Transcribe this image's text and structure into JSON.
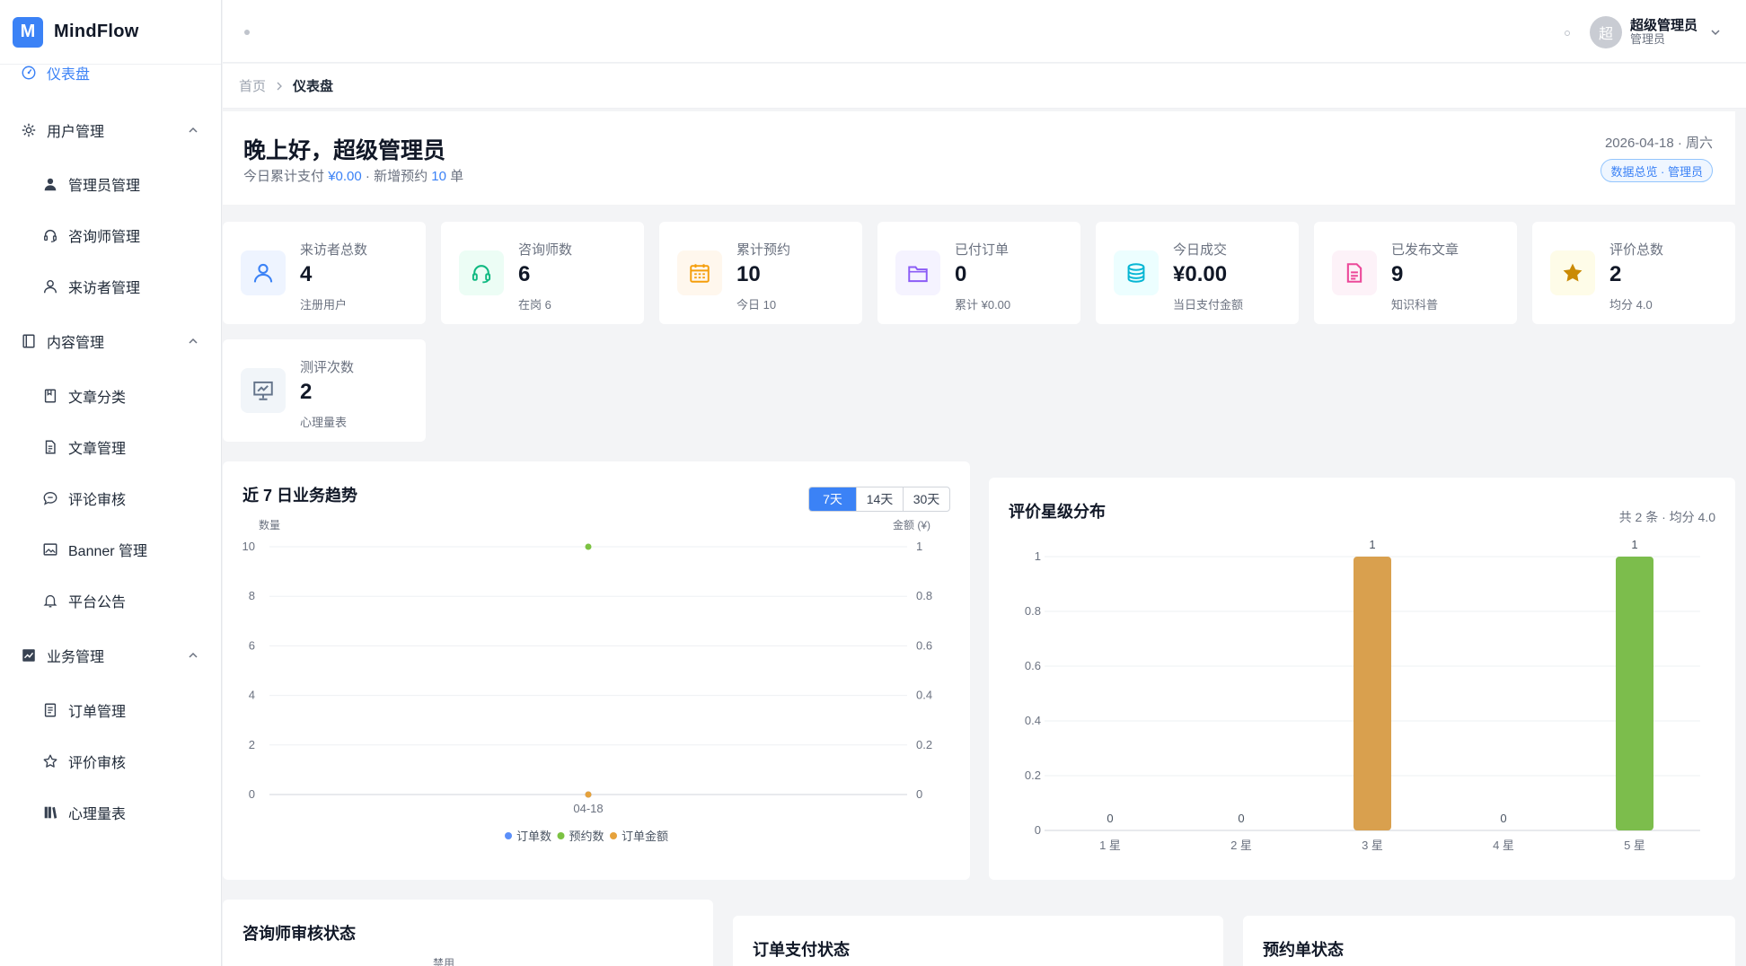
{
  "app": {
    "logo_letter": "M",
    "name": "MindFlow"
  },
  "sidebar": {
    "items": [
      {
        "label": "仪表盘",
        "icon": "dashboard-icon",
        "type": "top",
        "active": true
      },
      {
        "label": "用户管理",
        "icon": "gear-icon",
        "type": "group",
        "expanded": true
      },
      {
        "label": "管理员管理",
        "icon": "user-solid-icon",
        "type": "sub"
      },
      {
        "label": "咨询师管理",
        "icon": "headset-icon",
        "type": "sub"
      },
      {
        "label": "来访者管理",
        "icon": "user-outline-icon",
        "type": "sub"
      },
      {
        "label": "内容管理",
        "icon": "book-icon",
        "type": "group",
        "expanded": true
      },
      {
        "label": "文章分类",
        "icon": "bookmark-book-icon",
        "type": "sub"
      },
      {
        "label": "文章管理",
        "icon": "document-icon",
        "type": "sub"
      },
      {
        "label": "评论审核",
        "icon": "comment-icon",
        "type": "sub"
      },
      {
        "label": "Banner 管理",
        "icon": "image-icon",
        "type": "sub"
      },
      {
        "label": "平台公告",
        "icon": "bell-icon",
        "type": "sub"
      },
      {
        "label": "业务管理",
        "icon": "chart-trend-icon",
        "type": "group",
        "expanded": true
      },
      {
        "label": "订单管理",
        "icon": "receipt-icon",
        "type": "sub"
      },
      {
        "label": "评价审核",
        "icon": "star-outline-icon",
        "type": "sub"
      },
      {
        "label": "心理量表",
        "icon": "library-icon",
        "type": "sub"
      }
    ]
  },
  "header": {
    "user_avatar_char": "超",
    "user_name": "超级管理员",
    "user_role": "管理员"
  },
  "breadcrumb": {
    "home": "首页",
    "current": "仪表盘"
  },
  "welcome": {
    "greeting": "晚上好，超级管理员",
    "sub_prefix": "今日累计支付",
    "sub_amount": "¥0.00",
    "sub_mid": "· 新增预约",
    "sub_count": "10",
    "sub_suffix": "单",
    "date": "2026-04-18 · 周六",
    "tag": "数据总览 · 管理员"
  },
  "stats": [
    {
      "label": "来访者总数",
      "value": "4",
      "note": "注册用户",
      "icon": "user-icon",
      "color": "#3b82f6",
      "bg": "#eef4ff"
    },
    {
      "label": "咨询师数",
      "value": "6",
      "note": "在岗 6",
      "icon": "headset-icon",
      "color": "#10b981",
      "bg": "#ecfdf5"
    },
    {
      "label": "累计预约",
      "value": "10",
      "note": "今日 10",
      "icon": "calendar-icon",
      "color": "#f59e0b",
      "bg": "#fff7ed"
    },
    {
      "label": "已付订单",
      "value": "0",
      "note": "累计 ¥0.00",
      "icon": "folder-icon",
      "color": "#8b5cf6",
      "bg": "#f5f3ff"
    },
    {
      "label": "今日成交",
      "value": "¥0.00",
      "note": "当日支付金额",
      "icon": "database-icon",
      "color": "#06b6d4",
      "bg": "#ecfeff"
    },
    {
      "label": "已发布文章",
      "value": "9",
      "note": "知识科普",
      "icon": "article-icon",
      "color": "#ec4899",
      "bg": "#fdf2f8"
    },
    {
      "label": "评价总数",
      "value": "2",
      "note": "均分 4.0",
      "icon": "star-icon",
      "color": "#ca8a04",
      "bg": "#fefce8"
    },
    {
      "label": "测评次数",
      "value": "2",
      "note": "心理量表",
      "icon": "presentation-icon",
      "color": "#64748b",
      "bg": "#f1f5f9"
    }
  ],
  "trend_panel": {
    "title": "近 7 日业务趋势",
    "ranges": [
      "7天",
      "14天",
      "30天"
    ],
    "left_axis_label": "数量",
    "right_axis_label": "金额 (¥)"
  },
  "rating_panel": {
    "title": "评价星级分布",
    "meta": "共 2 条 · 均分 4.0"
  },
  "bottom_panels": {
    "counselor_review": "咨询师审核状态",
    "counselor_partial_label": "禁用",
    "order_payment": "订单支付状态",
    "appointment": "预约单状态"
  },
  "chart_data": [
    {
      "type": "line",
      "title": "近 7 日业务趋势",
      "x": [
        "04-18"
      ],
      "series": [
        {
          "name": "订单数",
          "values": [
            0
          ],
          "color": "#5b8ff9",
          "axis": "left"
        },
        {
          "name": "预约数",
          "values": [
            10
          ],
          "color": "#7cc242",
          "axis": "left"
        },
        {
          "name": "订单金额",
          "values": [
            0
          ],
          "color": "#e6a23c",
          "axis": "right"
        }
      ],
      "ylim_left": [
        0,
        10
      ],
      "yticks_left": [
        0,
        2,
        4,
        6,
        8,
        10
      ],
      "ylim_right": [
        0,
        1
      ],
      "yticks_right": [
        0,
        0.2,
        0.4,
        0.6,
        0.8,
        1
      ],
      "ylabel": "数量",
      "ylabel_right": "金额 (¥)",
      "legend": "bottom",
      "grid": true
    },
    {
      "type": "bar",
      "title": "评价星级分布",
      "categories": [
        "1 星",
        "2 星",
        "3 星",
        "4 星",
        "5 星"
      ],
      "values": [
        0,
        0,
        1,
        0,
        1
      ],
      "colors": [
        "#5b8ff9",
        "#5b8ff9",
        "#d9a04e",
        "#5b8ff9",
        "#7cbd4c"
      ],
      "ylim": [
        0,
        1
      ],
      "yticks": [
        0,
        0.2,
        0.4,
        0.6,
        0.8,
        1
      ],
      "data_labels": true,
      "grid": true
    }
  ]
}
